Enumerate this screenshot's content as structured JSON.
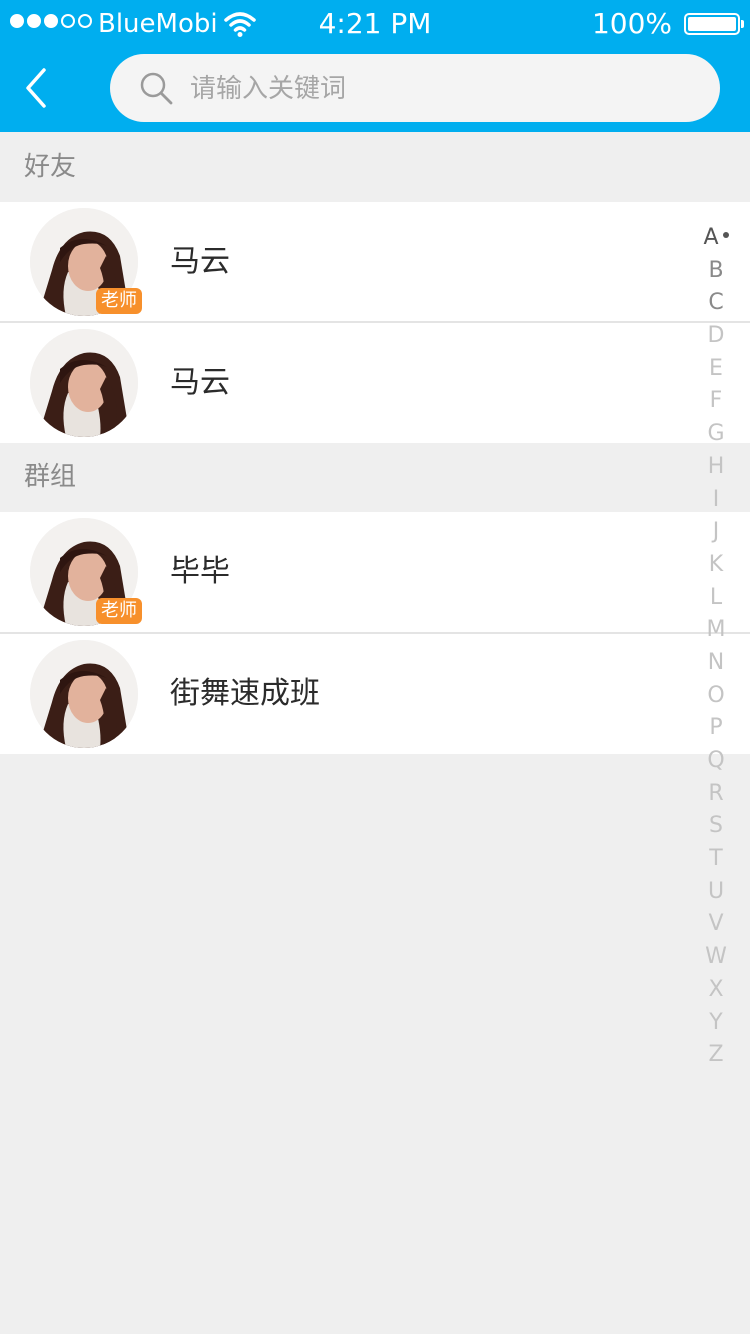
{
  "status_bar": {
    "carrier": "BlueMobi",
    "time": "4:21 PM",
    "battery": "100%",
    "signal_filled": 3,
    "signal_total": 5
  },
  "nav": {
    "back_icon": "chevron-left-icon",
    "search_icon": "search-icon",
    "search_placeholder": "请输入关键词",
    "search_value": ""
  },
  "sections": {
    "friends": {
      "title": "好友",
      "items": [
        {
          "name": "马云",
          "badge": "老师"
        },
        {
          "name": "马云",
          "badge": ""
        }
      ]
    },
    "groups": {
      "title": "群组",
      "items": [
        {
          "name": "毕毕",
          "badge": "老师"
        },
        {
          "name": "街舞速成班",
          "badge": ""
        }
      ]
    }
  },
  "index_letters": [
    "A",
    "B",
    "C",
    "D",
    "E",
    "F",
    "G",
    "H",
    "I",
    "J",
    "K",
    "L",
    "M",
    "N",
    "O",
    "P",
    "Q",
    "R",
    "S",
    "T",
    "U",
    "V",
    "W",
    "X",
    "Y",
    "Z"
  ],
  "index_active": "A",
  "colors": {
    "accent": "#00aeef",
    "badge": "#f7902c",
    "background": "#efefef"
  }
}
